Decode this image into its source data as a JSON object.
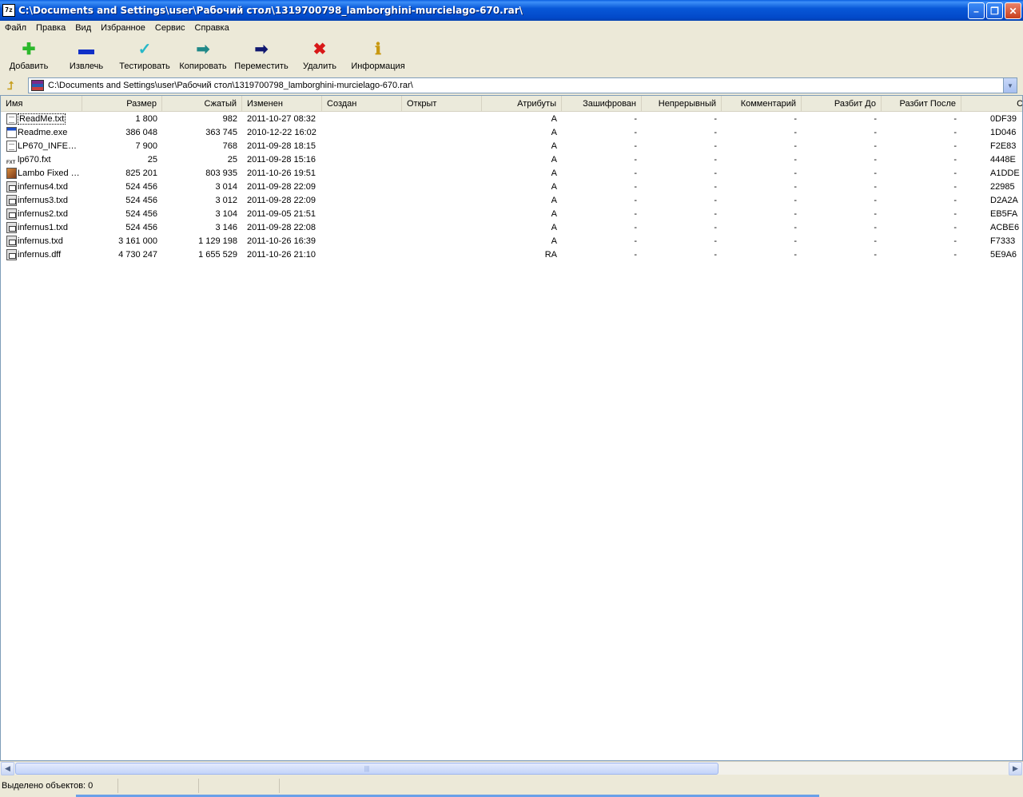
{
  "window": {
    "app_icon_text": "7z",
    "title": "C:\\Documents and Settings\\user\\Рабочий стол\\1319700798_lamborghini-murcielago-670.rar\\",
    "controls": {
      "minimize": "–",
      "maximize": "❐",
      "close": "✕"
    }
  },
  "menu": [
    "Файл",
    "Правка",
    "Вид",
    "Избранное",
    "Сервис",
    "Справка"
  ],
  "toolbar": [
    {
      "label": "Добавить",
      "icon": "plus-icon",
      "glyph": "✚",
      "color": "#2cb82c"
    },
    {
      "label": "Извлечь",
      "icon": "minus-icon",
      "glyph": "▬",
      "color": "#1030c8"
    },
    {
      "label": "Тестировать",
      "icon": "check-icon",
      "glyph": "✓",
      "color": "#28b8c8"
    },
    {
      "label": "Копировать",
      "icon": "copy-arrow-icon",
      "glyph": "➡",
      "color": "#208888"
    },
    {
      "label": "Переместить",
      "icon": "move-arrow-icon",
      "glyph": "➡",
      "color": "#101870"
    },
    {
      "label": "Удалить",
      "icon": "delete-icon",
      "glyph": "✖",
      "color": "#d81818"
    },
    {
      "label": "Информация",
      "icon": "info-icon",
      "glyph": "ℹ",
      "color": "#c89810"
    }
  ],
  "address": {
    "path": "C:\\Documents and Settings\\user\\Рабочий стол\\1319700798_lamborghini-murcielago-670.rar\\",
    "dropdown_glyph": "▼",
    "up_glyph": "⮥"
  },
  "columns": [
    "Имя",
    "Размер",
    "Сжатый",
    "Изменен",
    "Создан",
    "Открыт",
    "Атрибуты",
    "Зашифрован",
    "Непрерывный",
    "Комментарий",
    "Разбит До",
    "Разбит После",
    "CRC"
  ],
  "rows": [
    {
      "icon": "txt",
      "name": "ReadMe.txt",
      "size": "1 800",
      "packed": "982",
      "modified": "2011-10-27 08:32",
      "attr": "A",
      "enc": "-",
      "solid": "-",
      "comment": "-",
      "split_before": "-",
      "split_after": "-",
      "crc": "0DF39",
      "selected": true
    },
    {
      "icon": "exe",
      "name": "Readme.exe",
      "size": "386 048",
      "packed": "363 745",
      "modified": "2010-12-22 16:02",
      "attr": "A",
      "enc": "-",
      "solid": "-",
      "comment": "-",
      "split_before": "-",
      "split_after": "-",
      "crc": "1D046"
    },
    {
      "icon": "txt",
      "name": "LP670_INFE…",
      "size": "7 900",
      "packed": "768",
      "modified": "2011-09-28 18:15",
      "attr": "A",
      "enc": "-",
      "solid": "-",
      "comment": "-",
      "split_before": "-",
      "split_after": "-",
      "crc": "F2E83"
    },
    {
      "icon": "fxt",
      "name": "lp670.fxt",
      "size": "25",
      "packed": "25",
      "modified": "2011-09-28 15:16",
      "attr": "A",
      "enc": "-",
      "solid": "-",
      "comment": "-",
      "split_before": "-",
      "split_after": "-",
      "crc": "4448E"
    },
    {
      "icon": "img",
      "name": "Lambo Fixed …",
      "size": "825 201",
      "packed": "803 935",
      "modified": "2011-10-26 19:51",
      "attr": "A",
      "enc": "-",
      "solid": "-",
      "comment": "-",
      "split_before": "-",
      "split_after": "-",
      "crc": "A1DDE"
    },
    {
      "icon": "txd",
      "name": "infernus4.txd",
      "size": "524 456",
      "packed": "3 014",
      "modified": "2011-09-28 22:09",
      "attr": "A",
      "enc": "-",
      "solid": "-",
      "comment": "-",
      "split_before": "-",
      "split_after": "-",
      "crc": "22985"
    },
    {
      "icon": "txd",
      "name": "infernus3.txd",
      "size": "524 456",
      "packed": "3 012",
      "modified": "2011-09-28 22:09",
      "attr": "A",
      "enc": "-",
      "solid": "-",
      "comment": "-",
      "split_before": "-",
      "split_after": "-",
      "crc": "D2A2A"
    },
    {
      "icon": "txd",
      "name": "infernus2.txd",
      "size": "524 456",
      "packed": "3 104",
      "modified": "2011-09-05 21:51",
      "attr": "A",
      "enc": "-",
      "solid": "-",
      "comment": "-",
      "split_before": "-",
      "split_after": "-",
      "crc": "EB5FA"
    },
    {
      "icon": "txd",
      "name": "infernus1.txd",
      "size": "524 456",
      "packed": "3 146",
      "modified": "2011-09-28 22:08",
      "attr": "A",
      "enc": "-",
      "solid": "-",
      "comment": "-",
      "split_before": "-",
      "split_after": "-",
      "crc": "ACBE6"
    },
    {
      "icon": "txd",
      "name": "infernus.txd",
      "size": "3 161 000",
      "packed": "1 129 198",
      "modified": "2011-10-26 16:39",
      "attr": "A",
      "enc": "-",
      "solid": "-",
      "comment": "-",
      "split_before": "-",
      "split_after": "-",
      "crc": "F7333"
    },
    {
      "icon": "txd",
      "name": "infernus.dff",
      "size": "4 730 247",
      "packed": "1 655 529",
      "modified": "2011-10-26 21:10",
      "attr": "RA",
      "enc": "-",
      "solid": "-",
      "comment": "-",
      "split_before": "-",
      "split_after": "-",
      "crc": "5E9A6"
    }
  ],
  "scroll": {
    "left_glyph": "◀",
    "right_glyph": "▶",
    "grip": "|||"
  },
  "status": {
    "selected": "Выделено объектов: 0"
  }
}
